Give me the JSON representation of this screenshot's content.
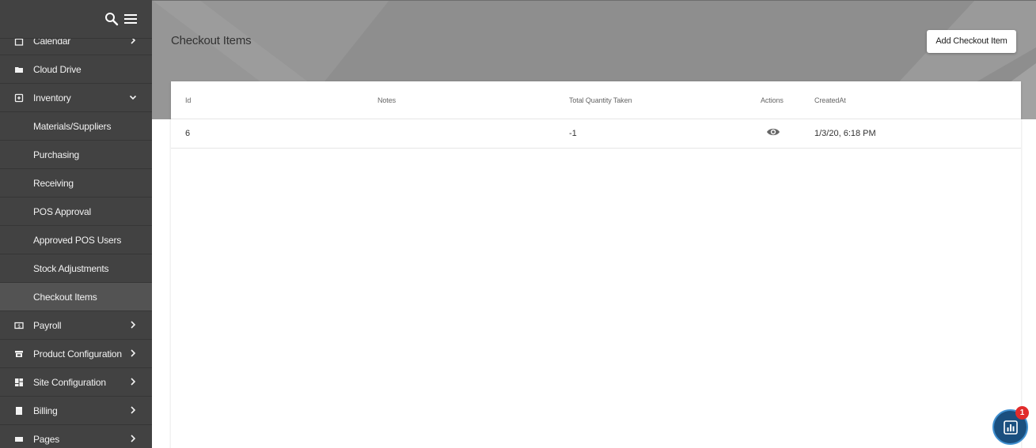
{
  "sidebar": {
    "items": [
      {
        "label": "Calendar",
        "icon": "calendar-icon",
        "chevron": "right"
      },
      {
        "label": "Cloud Drive",
        "icon": "folder-icon",
        "chevron": "none"
      },
      {
        "label": "Inventory",
        "icon": "inventory-icon",
        "chevron": "down"
      },
      {
        "label": "Materials/Suppliers",
        "sub": true
      },
      {
        "label": "Purchasing",
        "sub": true
      },
      {
        "label": "Receiving",
        "sub": true
      },
      {
        "label": "POS Approval",
        "sub": true
      },
      {
        "label": "Approved POS Users",
        "sub": true
      },
      {
        "label": "Stock Adjustments",
        "sub": true
      },
      {
        "label": "Checkout Items",
        "sub": true,
        "active": true
      },
      {
        "label": "Payroll",
        "icon": "payroll-icon",
        "chevron": "right"
      },
      {
        "label": "Product Configuration",
        "icon": "store-icon",
        "chevron": "right"
      },
      {
        "label": "Site Configuration",
        "icon": "dashboard-icon",
        "chevron": "right"
      },
      {
        "label": "Billing",
        "icon": "billing-icon",
        "chevron": "right"
      },
      {
        "label": "Pages",
        "icon": "page-icon",
        "chevron": "right"
      }
    ]
  },
  "header": {
    "title": "Checkout Items",
    "add_label": "Add Checkout Item"
  },
  "table": {
    "columns": [
      "Id",
      "Notes",
      "Total Quantity Taken",
      "Actions",
      "CreatedAt"
    ],
    "rows": [
      {
        "id": "6",
        "notes": "",
        "total_quantity_taken": "-1",
        "action": "view-icon",
        "created_at": "1/3/20, 6:18 PM"
      }
    ]
  },
  "widget": {
    "badge": "1"
  },
  "colors": {
    "sidebar": "#424242",
    "sidebar_active": "#535353",
    "hero": "#8c8c8c",
    "widget": "#1a4f7f",
    "badge": "#e12b2b"
  }
}
